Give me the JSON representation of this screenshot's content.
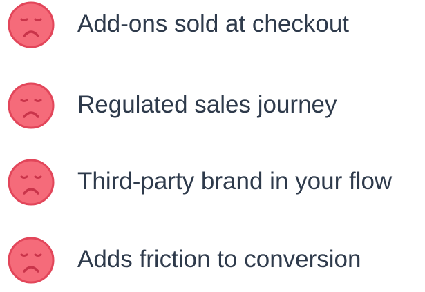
{
  "items": [
    {
      "label": "Add-ons sold at checkout",
      "icon": "sad-face-icon"
    },
    {
      "label": "Regulated sales journey",
      "icon": "sad-face-icon"
    },
    {
      "label": "Third-party brand in your flow",
      "icon": "sad-face-icon"
    },
    {
      "label": "Adds friction to conversion",
      "icon": "sad-face-icon"
    }
  ],
  "colors": {
    "face_fill": "#f56b7a",
    "face_stroke": "#e2465a",
    "face_features": "#c9344a",
    "text": "#2e3a4b"
  }
}
